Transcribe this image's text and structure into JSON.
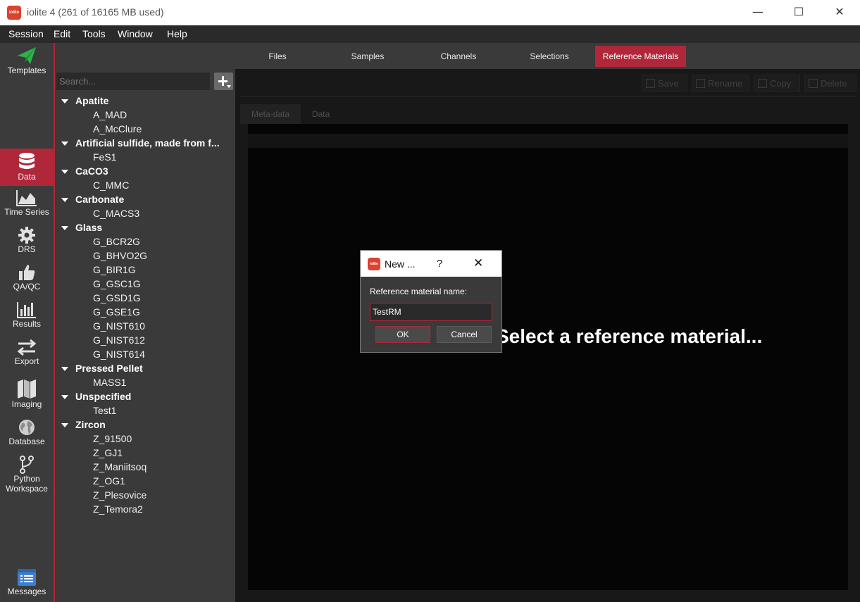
{
  "window": {
    "title": "iolite 4 (261 of 16165 MB used)",
    "app_icon_text": "iolite",
    "minimize": "—",
    "maximize": "☐",
    "close": "✕"
  },
  "menu": [
    "Session",
    "Edit",
    "Tools",
    "Window",
    "Help"
  ],
  "nav": {
    "templates": "Templates",
    "data": "Data",
    "time_series": "Time Series",
    "drs": "DRS",
    "qaqc": "QA/QC",
    "results": "Results",
    "export": "Export",
    "imaging": "Imaging",
    "database": "Database",
    "python_line1": "Python",
    "python_line2": "Workspace",
    "messages": "Messages"
  },
  "tabs": [
    "Files",
    "Samples",
    "Channels",
    "Selections",
    "Reference Materials"
  ],
  "search": {
    "placeholder": "Search..."
  },
  "tree": [
    {
      "group": "Apatite",
      "items": [
        "A_MAD",
        "A_McClure"
      ]
    },
    {
      "group": "Artificial sulfide, made from f...",
      "items": [
        "FeS1"
      ]
    },
    {
      "group": "CaCO3",
      "items": [
        "C_MMC"
      ]
    },
    {
      "group": "Carbonate",
      "items": [
        "C_MACS3"
      ]
    },
    {
      "group": "Glass",
      "items": [
        "G_BCR2G",
        "G_BHVO2G",
        "G_BIR1G",
        "G_GSC1G",
        "G_GSD1G",
        "G_GSE1G",
        "G_NIST610",
        "G_NIST612",
        "G_NIST614"
      ]
    },
    {
      "group": "Pressed Pellet",
      "items": [
        "MASS1"
      ]
    },
    {
      "group": "Unspecified",
      "items": [
        "Test1"
      ]
    },
    {
      "group": "Zircon",
      "items": [
        "Z_91500",
        "Z_GJ1",
        "Z_Maniitsoq",
        "Z_OG1",
        "Z_Plesovice",
        "Z_Temora2"
      ]
    }
  ],
  "toolbar": {
    "save": "Save",
    "rename": "Rename",
    "copy": "Copy",
    "delete": "Delete"
  },
  "subtabs": [
    "Meta-data",
    "Data"
  ],
  "main": {
    "placeholder": "Select a reference material..."
  },
  "dialog": {
    "title": "New ...",
    "help": "?",
    "close": "✕",
    "icon_text": "iolite",
    "label": "Reference material name:",
    "value": "TestRM",
    "ok": "OK",
    "cancel": "Cancel"
  },
  "colors": {
    "accent": "#b0273a",
    "app_icon": "#d9432f",
    "templates_icon": "#2db34a",
    "messages_icon": "#3f7fd0"
  }
}
